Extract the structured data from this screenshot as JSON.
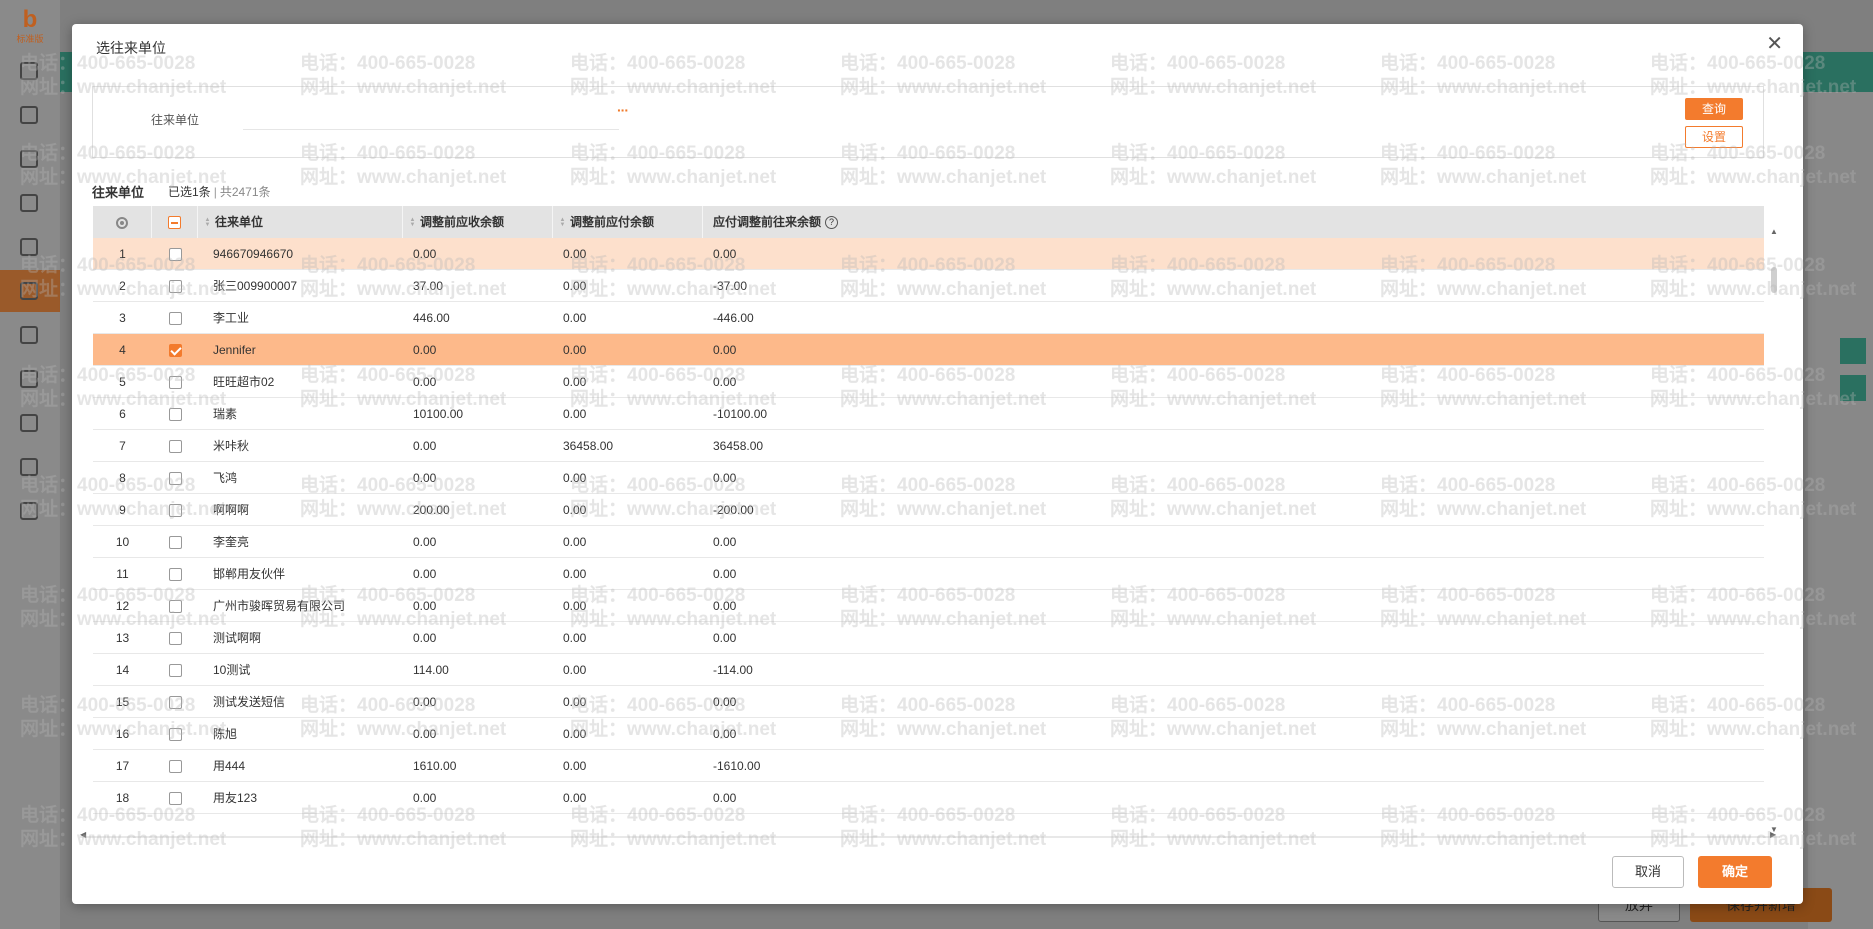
{
  "app": {
    "logo_text": "b",
    "logo_caption": "标准版",
    "bottom_cancel": "放弃",
    "bottom_save": "保存并新增"
  },
  "dialog": {
    "title": "选往来单位",
    "close_icon": "close-icon",
    "filter": {
      "label": "往来单位",
      "value": "",
      "more": "···",
      "query_button": "查询",
      "settings_button": "设置"
    },
    "grid_title": "往来单位",
    "selected_text": "已选1条",
    "separator": "|",
    "total_text": "共2471条",
    "columns": {
      "settings_icon": "gear-icon",
      "name": "往来单位",
      "receivable": "调整前应收余额",
      "payable": "调整前应付余额",
      "balance": "应付调整前往来余额",
      "help": "?"
    },
    "header_checkbox_state": "partial",
    "rows": [
      {
        "no": "1",
        "name": "946670946670",
        "recv": "0.00",
        "pay": "0.00",
        "bal": "0.00",
        "checked": false,
        "state": "hover"
      },
      {
        "no": "2",
        "name": "张三009900007",
        "recv": "37.00",
        "pay": "0.00",
        "bal": "-37.00",
        "checked": false,
        "state": ""
      },
      {
        "no": "3",
        "name": "李工业",
        "recv": "446.00",
        "pay": "0.00",
        "bal": "-446.00",
        "checked": false,
        "state": ""
      },
      {
        "no": "4",
        "name": "Jennifer",
        "recv": "0.00",
        "pay": "0.00",
        "bal": "0.00",
        "checked": true,
        "state": "sel"
      },
      {
        "no": "5",
        "name": "旺旺超市02",
        "recv": "0.00",
        "pay": "0.00",
        "bal": "0.00",
        "checked": false,
        "state": ""
      },
      {
        "no": "6",
        "name": "瑞素",
        "recv": "10100.00",
        "pay": "0.00",
        "bal": "-10100.00",
        "checked": false,
        "state": ""
      },
      {
        "no": "7",
        "name": "米咔秋",
        "recv": "0.00",
        "pay": "36458.00",
        "bal": "36458.00",
        "checked": false,
        "state": ""
      },
      {
        "no": "8",
        "name": "飞鸿",
        "recv": "0.00",
        "pay": "0.00",
        "bal": "0.00",
        "checked": false,
        "state": ""
      },
      {
        "no": "9",
        "name": "啊啊啊",
        "recv": "200.00",
        "pay": "0.00",
        "bal": "-200.00",
        "checked": false,
        "state": ""
      },
      {
        "no": "10",
        "name": "李奎亮",
        "recv": "0.00",
        "pay": "0.00",
        "bal": "0.00",
        "checked": false,
        "state": ""
      },
      {
        "no": "11",
        "name": "邯郸用友伙伴",
        "recv": "0.00",
        "pay": "0.00",
        "bal": "0.00",
        "checked": false,
        "state": ""
      },
      {
        "no": "12",
        "name": "广州市骏晖贸易有限公司",
        "recv": "0.00",
        "pay": "0.00",
        "bal": "0.00",
        "checked": false,
        "state": ""
      },
      {
        "no": "13",
        "name": "测试啊啊",
        "recv": "0.00",
        "pay": "0.00",
        "bal": "0.00",
        "checked": false,
        "state": ""
      },
      {
        "no": "14",
        "name": "10测试",
        "recv": "114.00",
        "pay": "0.00",
        "bal": "-114.00",
        "checked": false,
        "state": ""
      },
      {
        "no": "15",
        "name": "测试发送短信",
        "recv": "0.00",
        "pay": "0.00",
        "bal": "0.00",
        "checked": false,
        "state": ""
      },
      {
        "no": "16",
        "name": "陈旭",
        "recv": "0.00",
        "pay": "0.00",
        "bal": "0.00",
        "checked": false,
        "state": ""
      },
      {
        "no": "17",
        "name": "用444",
        "recv": "1610.00",
        "pay": "0.00",
        "bal": "-1610.00",
        "checked": false,
        "state": ""
      },
      {
        "no": "18",
        "name": "用友123",
        "recv": "0.00",
        "pay": "0.00",
        "bal": "0.00",
        "checked": false,
        "state": ""
      }
    ],
    "cancel_button": "取消",
    "ok_button": "确定"
  },
  "watermark": {
    "phone": "电话：400-665-0028",
    "phone_short": "400-665-0028",
    "site": "网址：www.chanjet.net",
    "site_short": "www.chanjet.net"
  },
  "colors": {
    "accent": "#f37b2d",
    "row_selected": "#fdb98a",
    "row_hover": "#fde0cc",
    "header_bg": "#e3e3e3"
  }
}
